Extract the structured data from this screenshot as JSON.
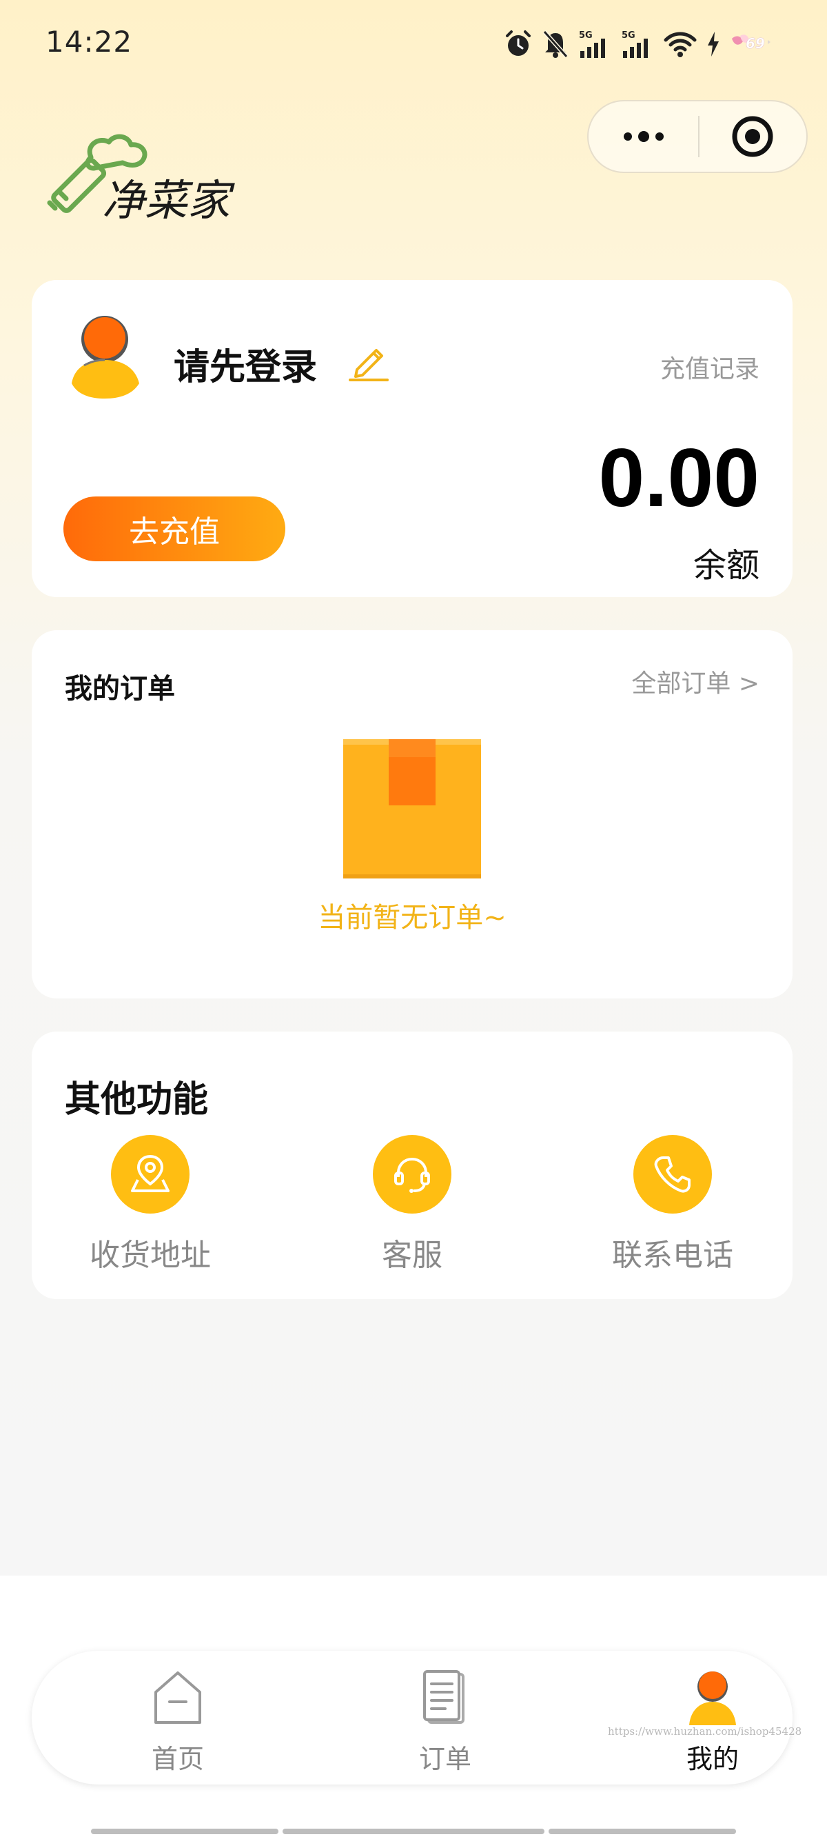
{
  "status_bar": {
    "time": "14:22",
    "battery": "69"
  },
  "user_card": {
    "login_prompt": "请先登录",
    "recharge_record": "充值记录",
    "balance_value": "0.00",
    "balance_label": "余额",
    "recharge_button": "去充值"
  },
  "orders": {
    "title": "我的订单",
    "view_all": "全部订单 >",
    "empty_text": "当前暂无订单~"
  },
  "functions": {
    "title": "其他功能",
    "items": [
      {
        "label": "收货地址",
        "icon": "location-icon"
      },
      {
        "label": "客服",
        "icon": "headset-icon"
      },
      {
        "label": "联系电话",
        "icon": "phone-icon"
      }
    ]
  },
  "tabbar": {
    "items": [
      {
        "label": "首页",
        "icon": "home-icon"
      },
      {
        "label": "订单",
        "icon": "orders-icon"
      },
      {
        "label": "我的",
        "icon": "profile-icon",
        "active": true
      }
    ]
  },
  "watermark": "https://www.huzhan.com/ishop45428",
  "colors": {
    "accent": "#ffbe12",
    "recharge_start": "#ff6a0a",
    "recharge_end": "#ffab12",
    "empty_text": "#f2b317"
  }
}
